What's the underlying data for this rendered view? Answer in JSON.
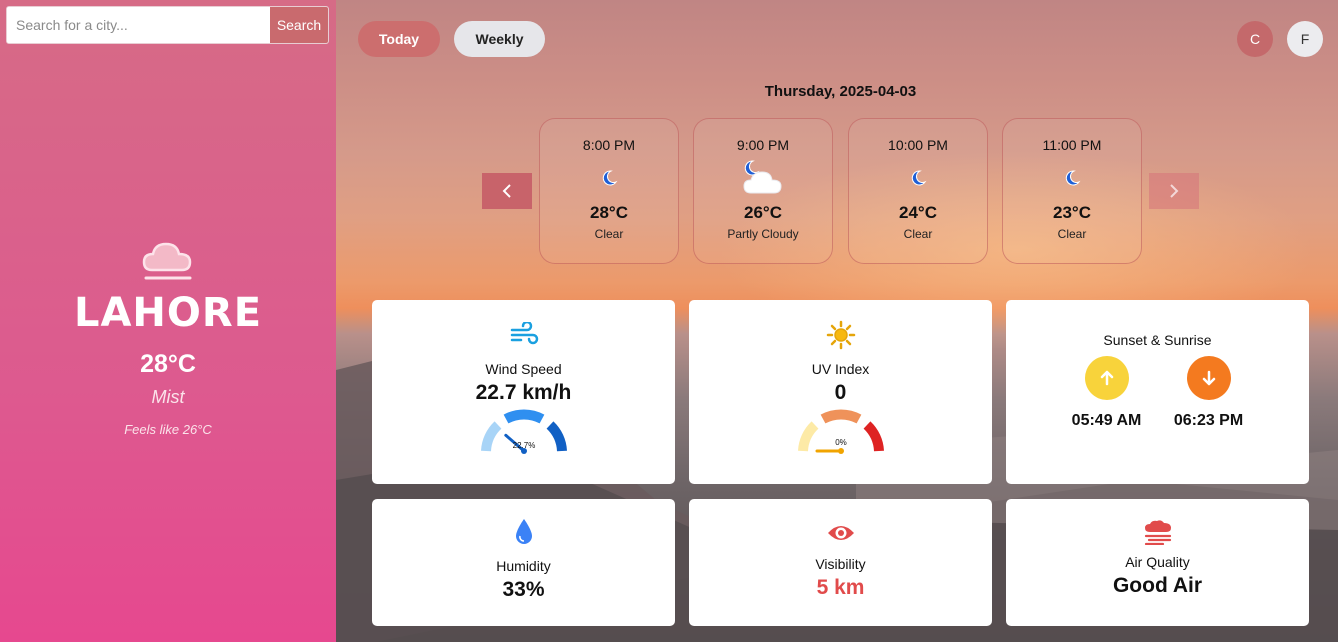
{
  "search": {
    "placeholder": "Search for a city...",
    "button_label": "Search"
  },
  "city": {
    "name": "LAHORE",
    "temperature": "28°C",
    "condition": "Mist",
    "feels_like": "Feels like 26°C",
    "icon": "cloud-icon"
  },
  "tabs": {
    "today": "Today",
    "weekly": "Weekly"
  },
  "units": {
    "celsius": "C",
    "fahrenheit": "F"
  },
  "date_title": "Thursday, 2025-04-03",
  "hourly": [
    {
      "time": "8:00 PM",
      "icon": "moon-icon",
      "temp": "28°C",
      "desc": "Clear"
    },
    {
      "time": "9:00 PM",
      "icon": "partly-cloudy-night-icon",
      "temp": "26°C",
      "desc": "Partly Cloudy"
    },
    {
      "time": "10:00 PM",
      "icon": "moon-icon",
      "temp": "24°C",
      "desc": "Clear"
    },
    {
      "time": "11:00 PM",
      "icon": "moon-icon",
      "temp": "23°C",
      "desc": "Clear"
    }
  ],
  "wind": {
    "label": "Wind Speed",
    "value": "22.7 km/h",
    "gauge_text": "22.7%",
    "gauge_fraction": 0.227,
    "icon": "wind-icon"
  },
  "uv": {
    "label": "UV Index",
    "value": "0",
    "gauge_text": "0%",
    "gauge_fraction": 0.0,
    "icon": "sun-icon"
  },
  "sun": {
    "label": "Sunset & Sunrise",
    "sunrise": "05:49 AM",
    "sunset": "06:23 PM",
    "sunrise_icon": "arrow-up-icon",
    "sunset_icon": "arrow-down-icon"
  },
  "humidity": {
    "label": "Humidity",
    "value": "33%",
    "icon": "droplet-icon"
  },
  "visibility": {
    "label": "Visibility",
    "value": "5 km",
    "icon": "eye-icon",
    "value_color": "#e14b4b"
  },
  "air_quality": {
    "label": "Air Quality",
    "value": "Good Air",
    "icon": "smog-icon"
  },
  "colors": {
    "sidebar_top": "#d66b86",
    "sidebar_bottom": "#e6488f",
    "accent": "#c96a6e",
    "sunrise": "#f8d33b",
    "sunset": "#f47a1f"
  }
}
